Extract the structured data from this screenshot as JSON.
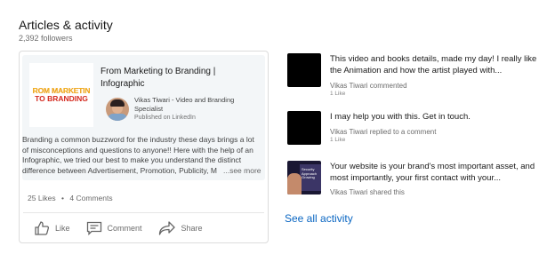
{
  "header": {
    "title": "Articles & activity",
    "followers": "2,392 followers"
  },
  "article": {
    "thumbnail": {
      "line1": "ROM MARKETIN",
      "line2": "TO BRANDING"
    },
    "title": "From Marketing to Branding | Infographic",
    "author": "Vikas Tiwari - Video and Branding Specialist",
    "published": "Published on LinkedIn",
    "excerpt_lines": [
      "Branding a common buzzword for the industry these days brings a lot",
      "of misconceptions and questions to anyone!! Here with the help of an",
      "Infographic, we tried our best to make you understand the distinct",
      "difference between Advertisement, Promotion, Publicity, M"
    ],
    "see_more": "...see more",
    "likes": "25 Likes",
    "separator": "•",
    "comments": "4 Comments",
    "actions": {
      "like": "Like",
      "comment": "Comment",
      "share": "Share"
    }
  },
  "activities": [
    {
      "text": "This video and books details, made my day! I really like the Animation and how the artist played with...",
      "meta": "Vikas Tiwari commented",
      "likes": "1 Like"
    },
    {
      "text": "I may help you with this. Get in touch.",
      "meta": "Vikas Tiwari replied to a comment",
      "likes": "1 Like"
    },
    {
      "text": "Your website is your brand's most important asset, and most importantly, your first contact with your...",
      "meta": "Vikas Tiwari shared this",
      "likes": ""
    }
  ],
  "see_all": "See all activity",
  "colors": {
    "link": "#0a66c2",
    "card_bg": "#f3f6f8"
  }
}
